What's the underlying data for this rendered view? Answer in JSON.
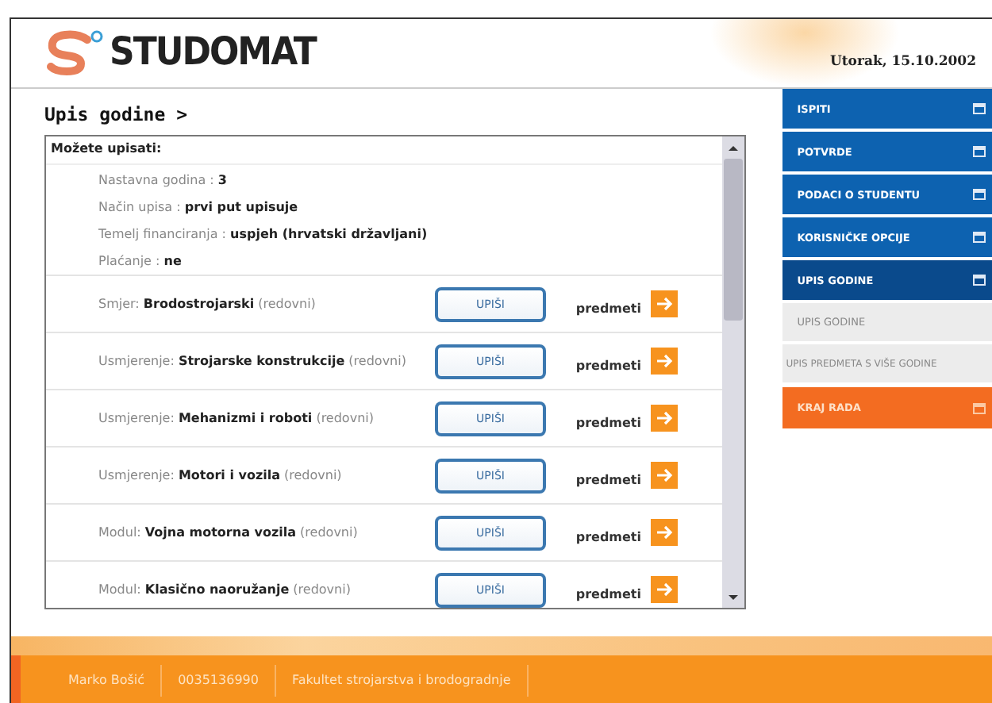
{
  "header": {
    "logo": "STUDOMAT",
    "date": "Utorak, 15.10.2002"
  },
  "page_title": "Upis godine >",
  "panel": {
    "heading": "Možete upisati:",
    "info": [
      "Nastavna godina : **3**",
      "Način upisa : **prvi put upisuje**",
      "Temelj financiranja : **uspjeh (hrvatski državljani)**",
      "Plaćanje : **ne**"
    ],
    "rows": [
      {
        "text": "Smjer: **Brodostrojarski** (redovni)",
        "button": "UPIŠI",
        "link": "predmeti"
      },
      {
        "text": "Usmjerenje: **Strojarske konstrukcije** (redovni)",
        "button": "UPIŠI",
        "link": "predmeti"
      },
      {
        "text": "Usmjerenje: **Mehanizmi i roboti** (redovni)",
        "button": "UPIŠI",
        "link": "predmeti"
      },
      {
        "text": "Usmjerenje: **Motori i vozila** (redovni)",
        "button": "UPIŠI",
        "link": "predmeti"
      },
      {
        "text": "Modul: **Vojna motorna vozila** (redovni)",
        "button": "UPIŠI",
        "link": "predmeti"
      },
      {
        "text": "Modul: **Klasično naoružanje** (redovni)",
        "button": "UPIŠI",
        "link": "predmeti"
      }
    ]
  },
  "menu": [
    {
      "label": "ISPITI",
      "kind": "main",
      "selected": false
    },
    {
      "label": "POTVRDE",
      "kind": "main",
      "selected": false
    },
    {
      "label": "PODACI O STUDENTU",
      "kind": "main",
      "selected": false
    },
    {
      "label": "KORISNIČKE OPCIJE",
      "kind": "main",
      "selected": false
    },
    {
      "label": "UPIS GODINE",
      "kind": "main",
      "selected": true
    },
    {
      "label": "UPIS GODINE",
      "kind": "sub",
      "selected": false
    },
    {
      "label": "UPIS PREDMETA S VIŠE GODINE",
      "kind": "sub",
      "selected": false
    },
    {
      "label": "KRAJ RADA",
      "kind": "exit",
      "selected": false
    }
  ],
  "footer": [
    "Marko Bošić",
    "0035136990",
    "Fakultet strojarstva i brodogradnje"
  ]
}
